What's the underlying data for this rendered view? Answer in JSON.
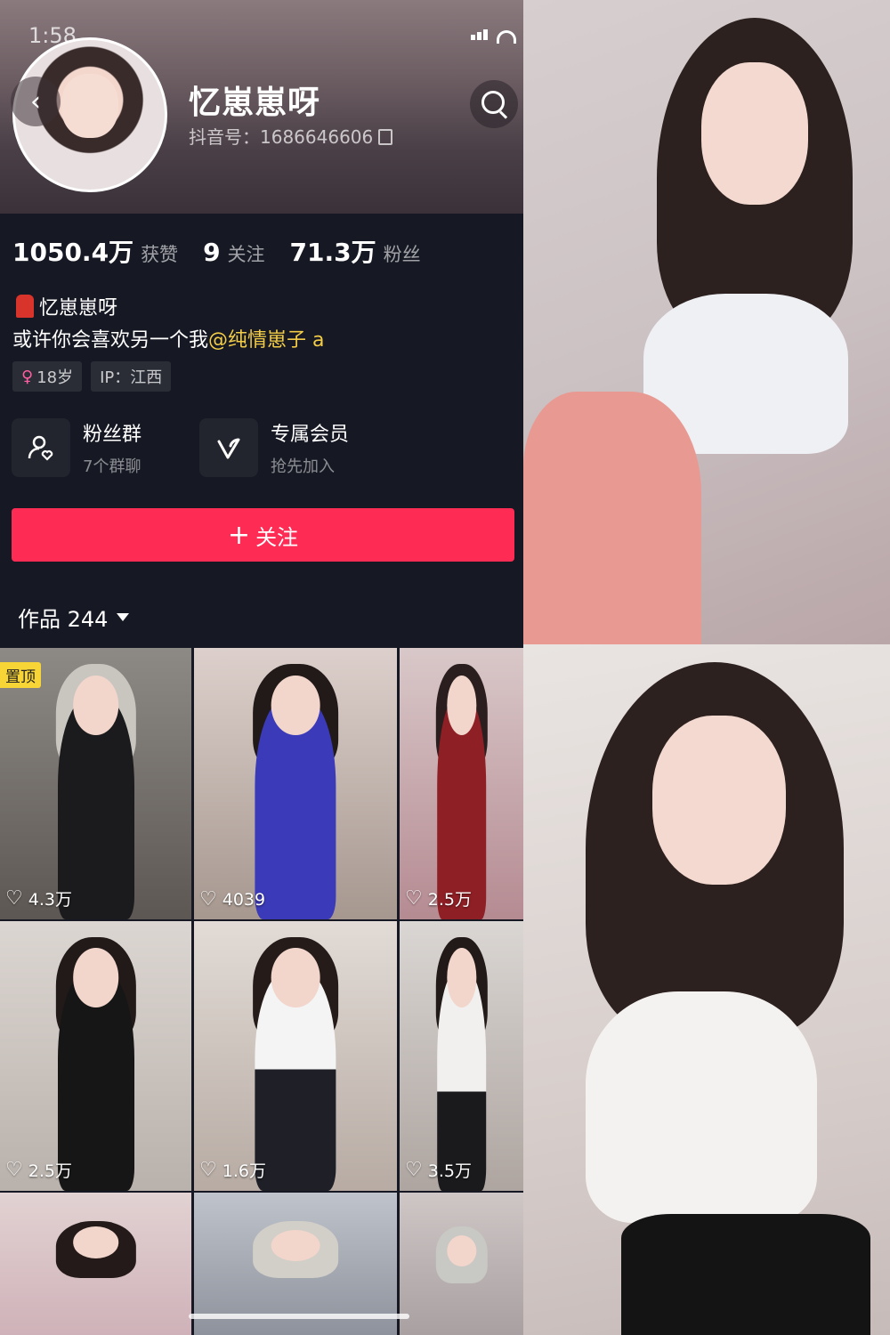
{
  "status_bar": {
    "time": "1:58"
  },
  "profile": {
    "name": "忆崽崽呀",
    "douyin_id": "抖音号：1686646606"
  },
  "stats": [
    {
      "value": "1050.4万",
      "label": "获赞"
    },
    {
      "value": "9",
      "label": "关注"
    },
    {
      "value": "71.3万",
      "label": "粉丝"
    }
  ],
  "bio": {
    "line1": "忆崽崽呀",
    "line2_prefix": "或许你会喜欢另一个我",
    "mention": "@纯情崽子 a"
  },
  "tags": {
    "age": "18岁",
    "ip": "IP：江西"
  },
  "features": [
    {
      "title": "粉丝群",
      "subtitle": "7个群聊",
      "icon": "user-group-icon"
    },
    {
      "title": "专属会员",
      "subtitle": "抢先加入",
      "icon": "vip-v-icon"
    }
  ],
  "follow_button": {
    "label": "关注"
  },
  "works_tab": {
    "label": "作品 244"
  },
  "pinned_label": "置顶",
  "videos": [
    {
      "likes": "4.3万",
      "pinned": true
    },
    {
      "likes": "4039",
      "pinned": false
    },
    {
      "likes": "2.5万",
      "pinned": false
    },
    {
      "likes": "2.5万",
      "pinned": false
    },
    {
      "likes": "1.6万",
      "pinned": false
    },
    {
      "likes": "3.5万",
      "pinned": false
    },
    {
      "likes": "",
      "pinned": false
    },
    {
      "likes": "",
      "pinned": false
    },
    {
      "likes": "",
      "pinned": false
    }
  ],
  "colors": {
    "background": "#161823",
    "follow_button": "#fe2c55",
    "mention": "#f3cd47",
    "pinned_badge": "#f8d536"
  }
}
